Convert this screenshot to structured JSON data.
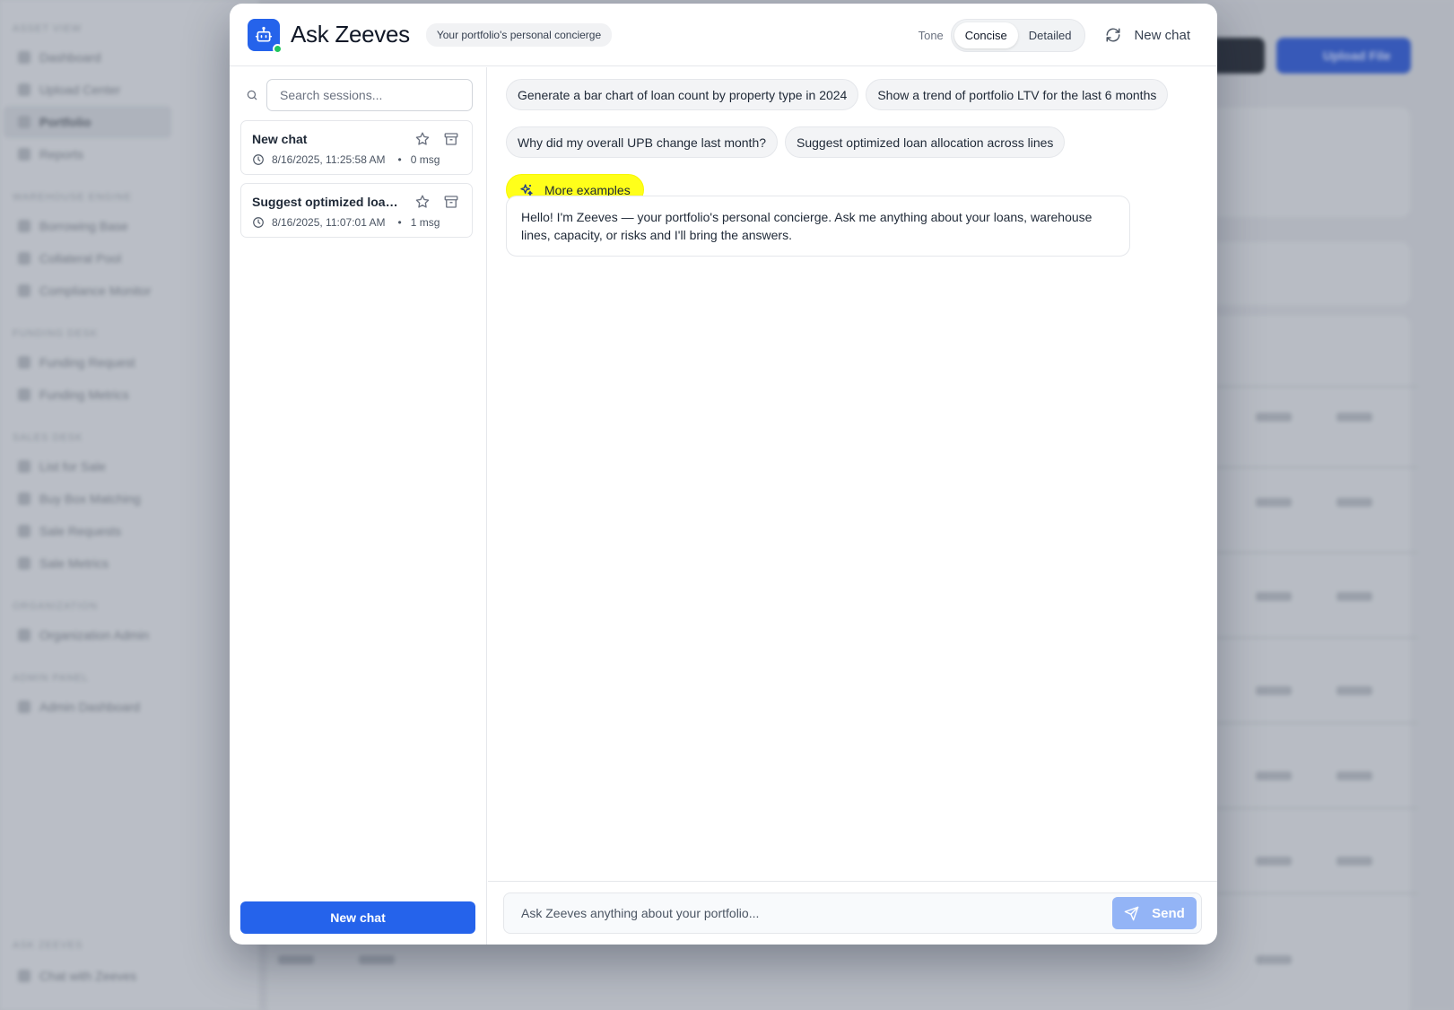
{
  "background": {
    "sidebar_sections": [
      {
        "heading": "ASSET VIEW",
        "items": [
          "Dashboard",
          "Upload Center",
          "Portfolio",
          "Reports"
        ]
      },
      {
        "heading": "WAREHOUSE ENGINE",
        "items": [
          "Borrowing Base",
          "Collateral Pool",
          "Compliance Monitor"
        ]
      },
      {
        "heading": "FUNDING DESK",
        "items": [
          "Funding Request",
          "Funding Metrics"
        ]
      },
      {
        "heading": "SALES DESK",
        "items": [
          "List for Sale",
          "Buy Box Matching",
          "Sale Requests",
          "Sale Metrics"
        ]
      },
      {
        "heading": "ORGANIZATION",
        "items": [
          "Organization Admin"
        ]
      },
      {
        "heading": "ADMIN PANEL",
        "items": [
          "Admin Dashboard"
        ]
      }
    ],
    "footer_heading": "ASK ZEEVES",
    "footer_item": "Chat with Zeeves",
    "upload_button": "Upload File"
  },
  "header": {
    "title": "Ask Zeeves",
    "tagline": "Your portfolio's personal concierge",
    "tone_label": "Tone",
    "tone_options": [
      "Concise",
      "Detailed"
    ],
    "tone_selected": "Concise",
    "new_chat_label": "New chat"
  },
  "sidebar": {
    "search_placeholder": "Search sessions...",
    "sessions": [
      {
        "title": "New chat",
        "timestamp": "8/16/2025, 11:25:58 AM",
        "bullet": "•",
        "count": "0 msg"
      },
      {
        "title": "Suggest optimized loan allocation across lines",
        "timestamp": "8/16/2025, 11:07:01 AM",
        "bullet": "•",
        "count": "1 msg"
      }
    ],
    "new_chat_button": "New chat"
  },
  "chat": {
    "suggestions": [
      "Generate a bar chart of loan count by property type in 2024",
      "Show a trend of portfolio LTV for the last 6 months",
      "Why did my overall UPB change last month?",
      "Suggest optimized loan allocation across lines"
    ],
    "more_examples": "More examples",
    "assistant_message": "Hello! I'm Zeeves — your portfolio's personal concierge. Ask me anything about your loans, warehouse lines, capacity, or risks and I'll bring the answers.",
    "composer_placeholder": "Ask Zeeves anything about your portfolio...",
    "send_label": "Send"
  },
  "colors": {
    "accent": "#2563eb",
    "online": "#22c55e",
    "highlight": "#ffff1a",
    "send_disabled": "#93b4f6"
  }
}
